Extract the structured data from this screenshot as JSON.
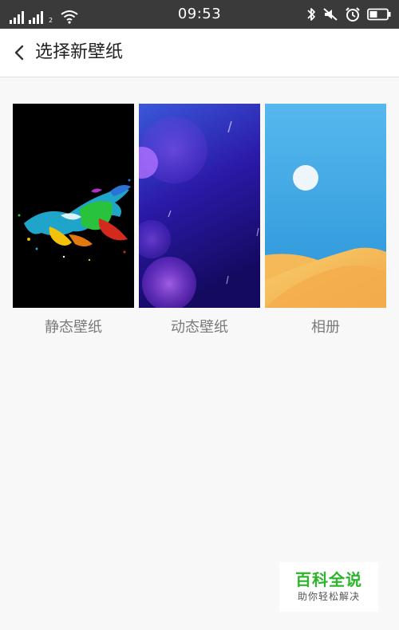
{
  "status_bar": {
    "time": "09:53",
    "sim1_badge": "",
    "sim2_badge": "2",
    "icons": [
      "signal-icon",
      "signal-icon",
      "wifi-icon",
      "bluetooth-icon",
      "mute-icon",
      "alarm-icon",
      "battery-icon"
    ]
  },
  "header": {
    "back_icon": "chevron-left-icon",
    "title": "选择新壁纸"
  },
  "options": [
    {
      "label": "静态壁纸",
      "thumbnail": "static-wallpaper-preview"
    },
    {
      "label": "动态壁纸",
      "thumbnail": "live-wallpaper-preview"
    },
    {
      "label": "相册",
      "thumbnail": "album-preview"
    }
  ],
  "watermark": {
    "title": "百科全说",
    "subtitle": "助你轻松解决"
  },
  "colors": {
    "status_bar_bg": "#3a3a3a",
    "page_bg": "#f8f8f8",
    "label_text": "#7a7a7a",
    "watermark_green": "#2ab52a",
    "album_sky": "#4aaee8",
    "album_sand": "#f5b04e",
    "live_purple": "#5a2ad8"
  }
}
